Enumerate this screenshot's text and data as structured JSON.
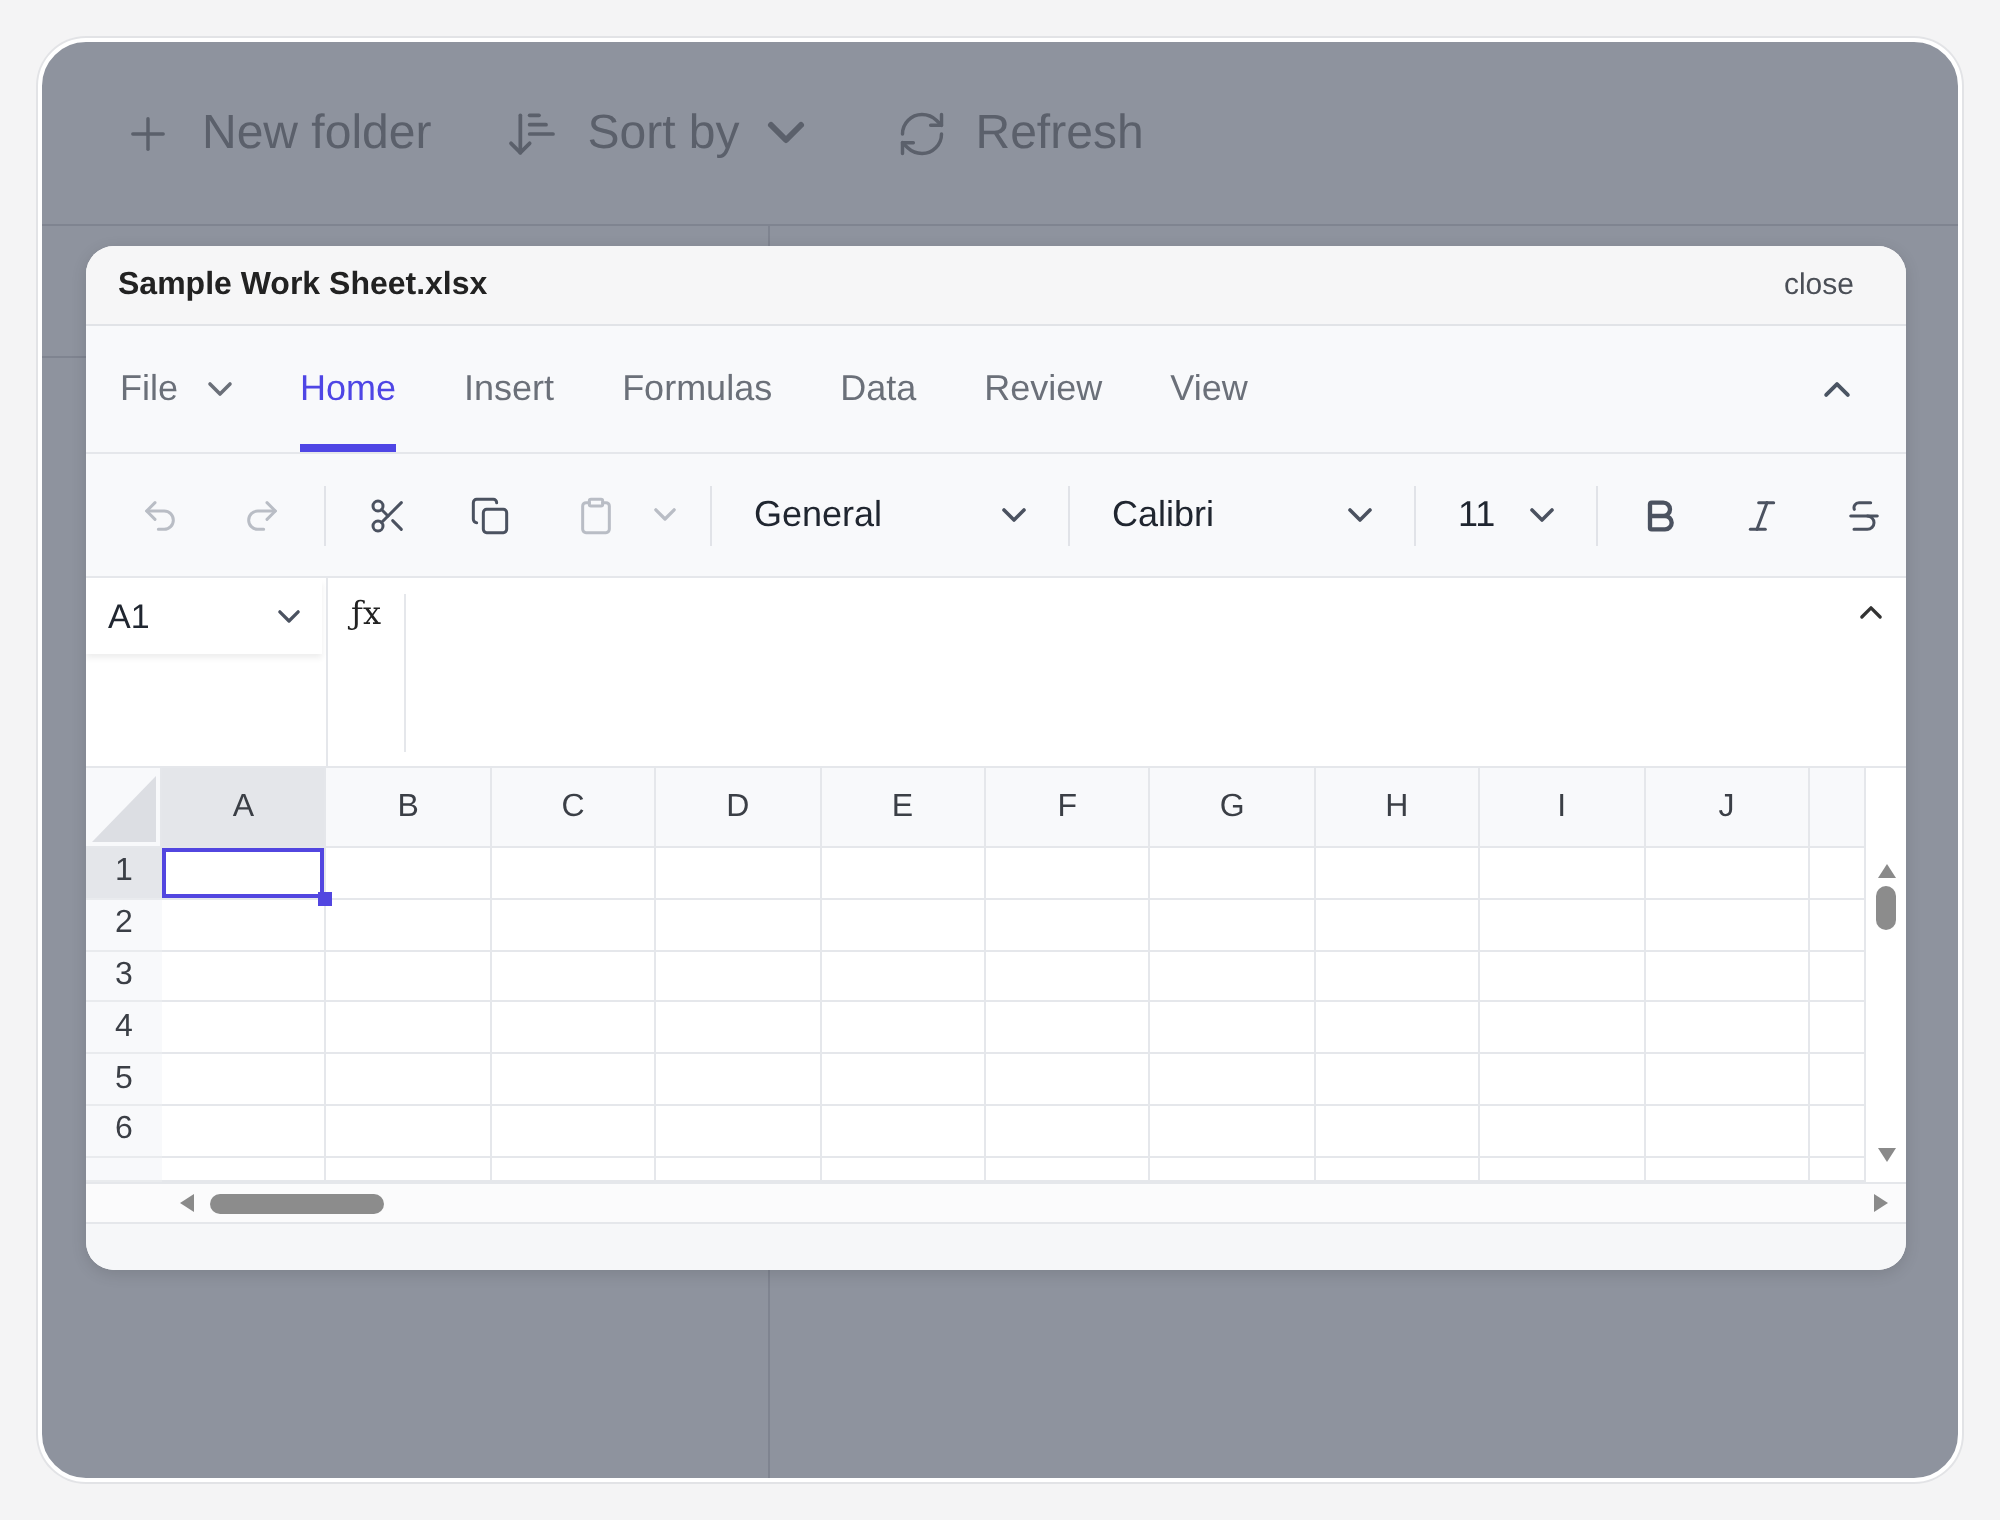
{
  "background_toolbar": [
    {
      "kind": "add",
      "label": "New folder"
    },
    {
      "kind": "sort",
      "label": "Sort by"
    },
    {
      "kind": "refresh",
      "label": "Refresh"
    }
  ],
  "dialog": {
    "title": "Sample Work Sheet.xlsx",
    "close_label": "close"
  },
  "ribbon": {
    "expanded": true,
    "tabs": [
      {
        "kind": "menu",
        "label": "File",
        "selected": false
      },
      {
        "kind": "tab",
        "label": "Home",
        "selected": true
      },
      {
        "kind": "tab",
        "label": "Insert",
        "selected": false
      },
      {
        "kind": "tab",
        "label": "Formulas",
        "selected": false
      },
      {
        "kind": "tab",
        "label": "Data",
        "selected": false
      },
      {
        "kind": "tab",
        "label": "Review",
        "selected": false
      },
      {
        "kind": "tab",
        "label": "View",
        "selected": false
      }
    ]
  },
  "toolbar": [
    {
      "kind": "undo",
      "disabled": true
    },
    {
      "kind": "redo",
      "disabled": true
    },
    {
      "kind": "separator"
    },
    {
      "kind": "cut",
      "disabled": false
    },
    {
      "kind": "copy",
      "disabled": false
    },
    {
      "kind": "paste",
      "disabled": true
    },
    {
      "kind": "separator"
    },
    {
      "kind": "number_format",
      "value": "General"
    },
    {
      "kind": "separator"
    },
    {
      "kind": "font_family",
      "value": "Calibri"
    },
    {
      "kind": "separator"
    },
    {
      "kind": "font_size",
      "value": "11"
    },
    {
      "kind": "separator"
    },
    {
      "kind": "bold",
      "disabled": false
    },
    {
      "kind": "italic",
      "disabled": false
    },
    {
      "kind": "strikethrough",
      "disabled": false
    }
  ],
  "formula_bar": {
    "name_box": "A1",
    "function_symbol": "ƒx",
    "expanded": true
  },
  "grid": {
    "columns": [
      {
        "label": "A",
        "selected": true
      },
      {
        "label": "B",
        "selected": false
      },
      {
        "label": "C",
        "selected": false
      },
      {
        "label": "D",
        "selected": false
      },
      {
        "label": "E",
        "selected": false
      },
      {
        "label": "F",
        "selected": false
      },
      {
        "label": "G",
        "selected": false
      },
      {
        "label": "H",
        "selected": false
      },
      {
        "label": "I",
        "selected": false
      },
      {
        "label": "J",
        "selected": false
      }
    ],
    "rows": [
      {
        "label": "1",
        "selected": true
      },
      {
        "label": "2",
        "selected": false
      },
      {
        "label": "3",
        "selected": false
      },
      {
        "label": "4",
        "selected": false
      },
      {
        "label": "5",
        "selected": false
      },
      {
        "label": "6",
        "selected": false
      }
    ]
  }
}
